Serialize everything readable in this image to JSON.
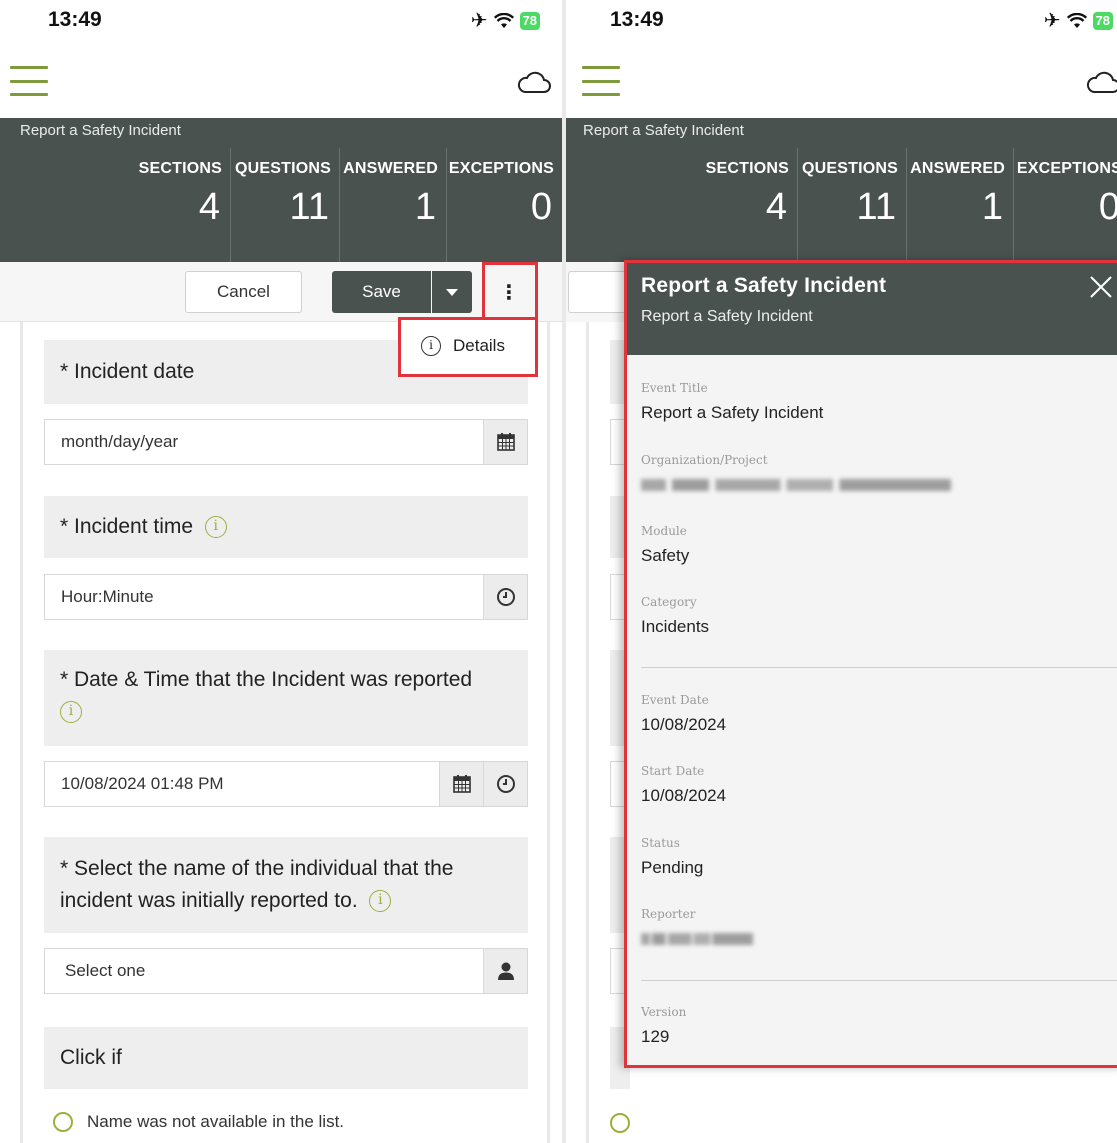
{
  "status_bar": {
    "time": "13:49",
    "battery": "78"
  },
  "header": {
    "title": "Report a Safety Incident",
    "stats": [
      {
        "label": "SECTIONS",
        "value": "4"
      },
      {
        "label": "QUESTIONS",
        "value": "11"
      },
      {
        "label": "ANSWERED",
        "value": "1"
      },
      {
        "label": "EXCEPTIONS",
        "value": "0"
      }
    ]
  },
  "toolbar": {
    "cancel_label": "Cancel",
    "save_label": "Save"
  },
  "menu": {
    "details_label": "Details"
  },
  "form": {
    "q1_label": "* Incident date",
    "q1_placeholder": "month/day/year",
    "q2_label": "* Incident time",
    "q2_placeholder": "Hour:Minute",
    "q3_label": "* Date & Time that the Incident was reported",
    "q3_value": "10/08/2024 01:48 PM",
    "q4_label": "* Select the name of the individual that the incident was initially reported to.",
    "q4_value": "Select one",
    "q5_label": "Click if",
    "radio_label": "Name was not available in the list."
  },
  "details_panel": {
    "title": "Report a Safety Incident",
    "subtitle": "Report a Safety Incident",
    "fields": {
      "event_title_label": "Event Title",
      "event_title_value": "Report a Safety Incident",
      "org_label": "Organization/Project",
      "module_label": "Module",
      "module_value": "Safety",
      "category_label": "Category",
      "category_value": "Incidents",
      "event_date_label": "Event Date",
      "event_date_value": "10/08/2024",
      "start_date_label": "Start Date",
      "start_date_value": "10/08/2024",
      "status_label": "Status",
      "status_value": "Pending",
      "reporter_label": "Reporter",
      "version_label": "Version",
      "version_value": "129"
    }
  },
  "colors": {
    "accent": "#7f9a3a",
    "header_bg": "#4a5250",
    "highlight": "#e0333b"
  }
}
